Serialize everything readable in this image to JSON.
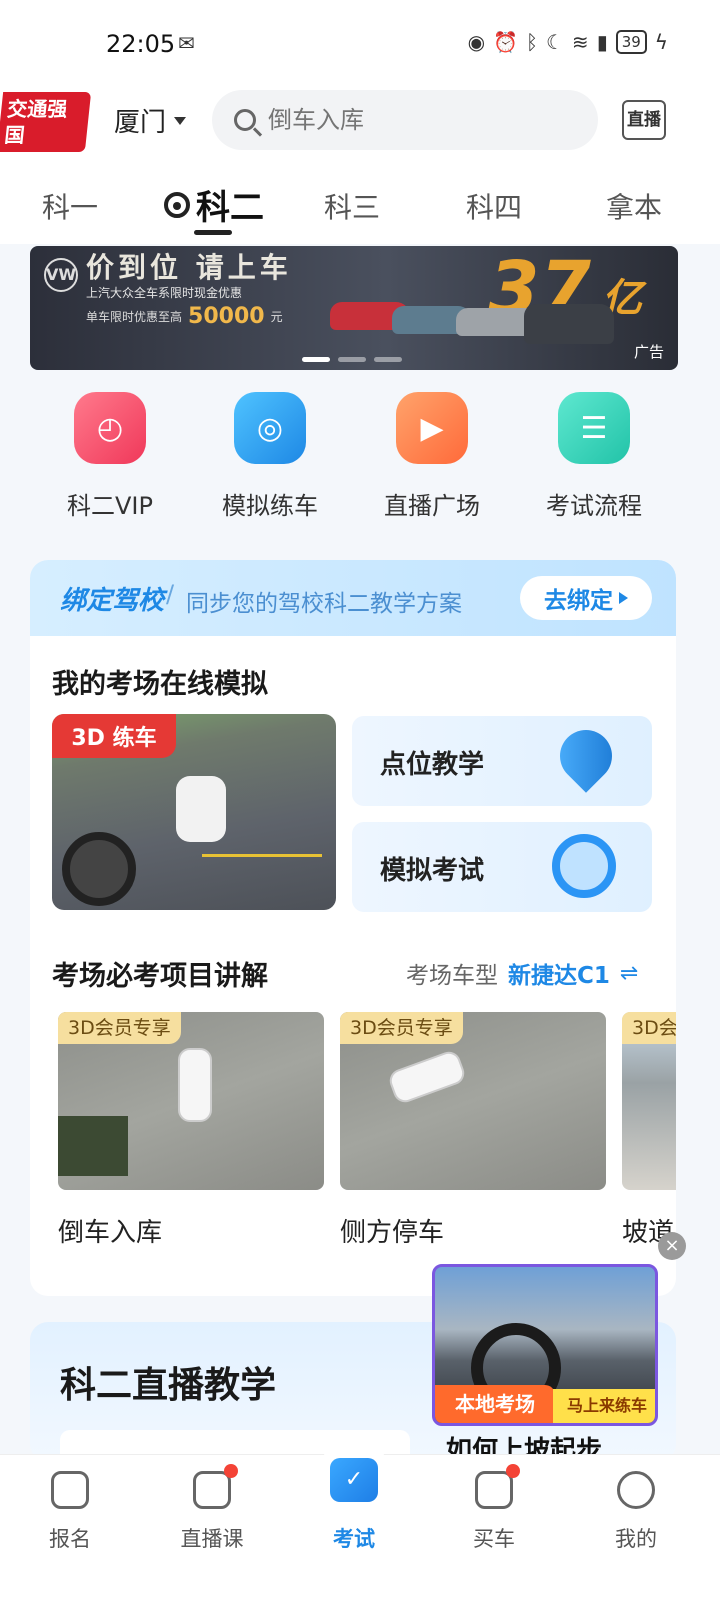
{
  "status": {
    "time": "22:05",
    "battery": "39"
  },
  "header": {
    "logo_text": "交通强国",
    "city": "厦门",
    "search_placeholder": "倒车入库",
    "live_label": "直播"
  },
  "tabs": [
    "科一",
    "科二",
    "科三",
    "科四",
    "拿本"
  ],
  "banner": {
    "headline": "价到位 请上车",
    "sub": "上汽大众全车系限时现金优惠",
    "promo_prefix": "单车限时优惠至高",
    "promo_amount": "50000",
    "promo_unit": "元",
    "big": "37",
    "big_unit": "亿",
    "ad_label": "广告"
  },
  "quick": [
    "科二VIP",
    "模拟练车",
    "直播广场",
    "考试流程"
  ],
  "bind": {
    "title": "绑定驾校",
    "slash": "/",
    "desc": "同步您的驾校科二教学方案",
    "button": "去绑定"
  },
  "sim": {
    "title": "我的考场在线模拟",
    "tag": "3D 练车",
    "btn1": "点位教学",
    "btn2": "模拟考试"
  },
  "must": {
    "title": "考场必考项目讲解",
    "car_label": "考场车型",
    "car_value": "新捷达C1",
    "swap": "⇌",
    "vip_tag": "3D会员专享",
    "items": [
      "倒车入库",
      "侧方停车",
      "坡道"
    ]
  },
  "live": {
    "title": "科二直播教学"
  },
  "float_ad": {
    "badge1": "本地考场",
    "badge2": "马上来练车",
    "caption": "如何上坡起步"
  },
  "nav": [
    "报名",
    "直播课",
    "考试",
    "买车",
    "我的"
  ]
}
